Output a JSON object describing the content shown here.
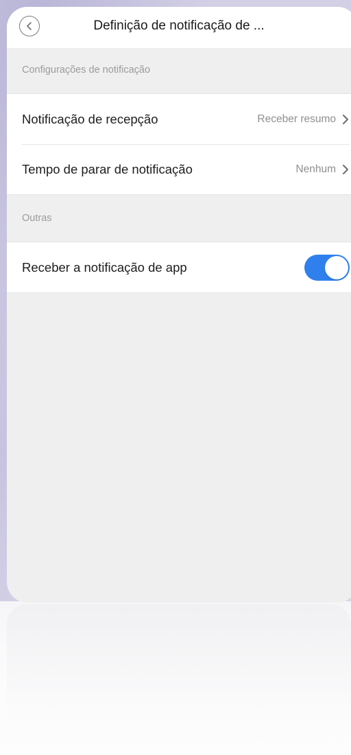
{
  "header": {
    "title": "Definição de notificação de ..."
  },
  "sections": [
    {
      "title": "Configurações de notificação",
      "rows": [
        {
          "label": "Notificação de recepção",
          "value": "Receber resumo"
        },
        {
          "label": "Tempo de parar de notificação",
          "value": "Nenhum"
        }
      ]
    },
    {
      "title": "Outras",
      "rows": [
        {
          "label": "Receber a notificação de app",
          "toggle_on": true
        }
      ]
    }
  ],
  "icons": {
    "back": "chevron-left-icon",
    "row_arrow": "chevron-right-icon"
  },
  "colors": {
    "accent": "#2f80ed",
    "screen_background": "#efefef",
    "card_background": "#ffffff"
  }
}
